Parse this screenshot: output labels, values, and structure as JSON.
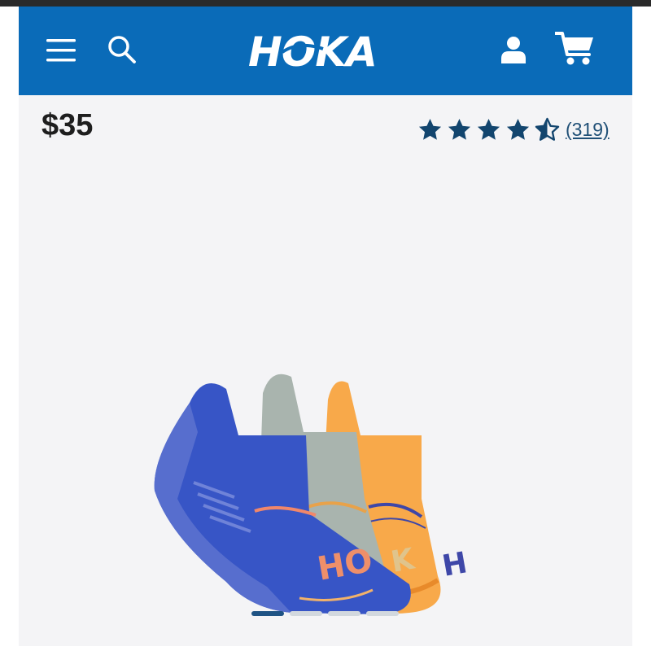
{
  "brand": {
    "logo_text": "HOKA",
    "header_color": "#0a6bb8"
  },
  "header": {
    "icons": {
      "menu": "menu-icon",
      "search": "search-icon",
      "account": "user-icon",
      "cart": "cart-icon"
    }
  },
  "product": {
    "price": "$35",
    "rating": {
      "value": 4.5,
      "max": 5,
      "count_label": "(319)"
    }
  },
  "gallery": {
    "total_images": 4,
    "active_index": 0
  },
  "colors": {
    "star": "#12456e",
    "rating_link": "#1f4f76",
    "active_dot": "#1f5384",
    "inactive_dot": "#d2d8de"
  }
}
